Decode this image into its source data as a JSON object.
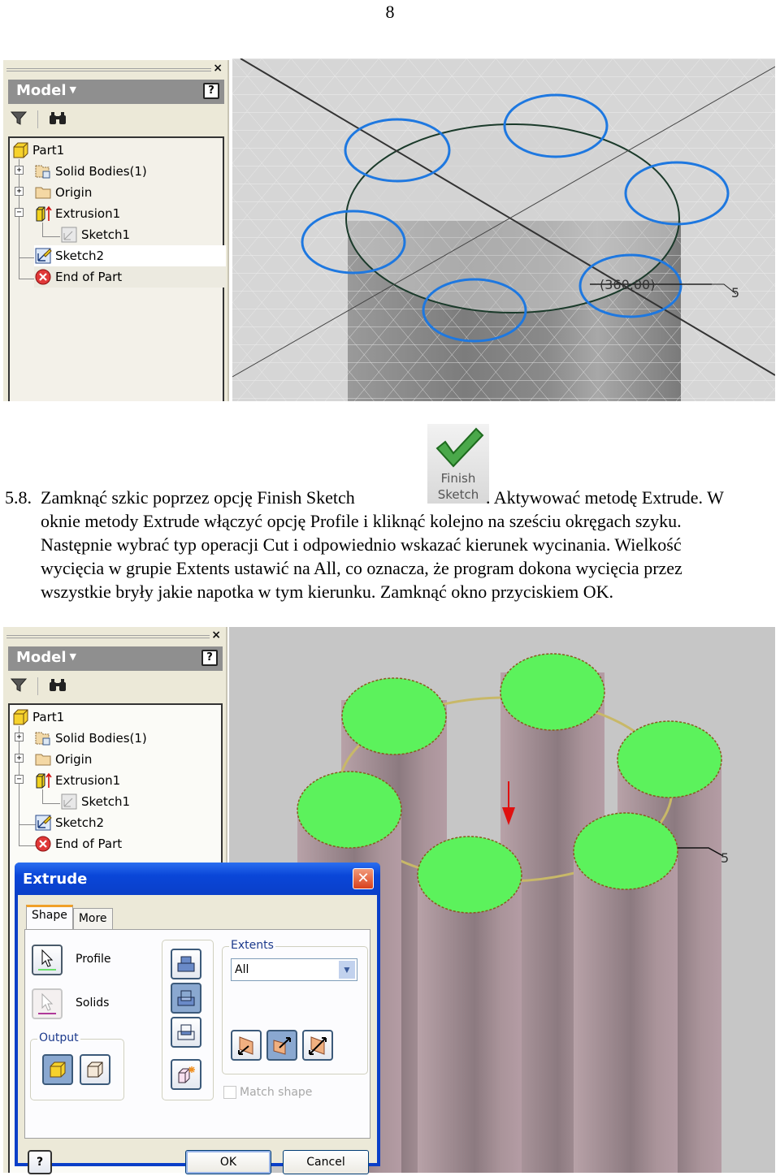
{
  "page": {
    "number": "8"
  },
  "browser": {
    "title": "Model",
    "close_glyph": "×",
    "help_glyph": "?",
    "tools": [
      {
        "icon": "filter-icon"
      },
      {
        "icon": "binoculars-icon"
      }
    ],
    "tree": [
      {
        "label": "Part1",
        "icon": "part-icon",
        "level": 0,
        "expander": ""
      },
      {
        "label": "Solid Bodies(1)",
        "icon": "solid-bodies-icon",
        "level": 1,
        "expander": "+"
      },
      {
        "label": "Origin",
        "icon": "folder-icon",
        "level": 1,
        "expander": "+"
      },
      {
        "label": "Extrusion1",
        "icon": "extrusion-icon",
        "level": 1,
        "expander": "−"
      },
      {
        "label": "Sketch1",
        "icon": "sketch-icon",
        "level": 2,
        "expander": ""
      },
      {
        "label": "Sketch2",
        "icon": "sketch-active-icon",
        "level": 1,
        "expander": "",
        "selected": true
      },
      {
        "label": "End of Part",
        "icon": "end-of-part-icon",
        "level": 1,
        "expander": ""
      }
    ]
  },
  "viewport_top": {
    "sketch_circles": 6,
    "dimension_label": "(360,00)",
    "pattern_count_label": "5",
    "colors": {
      "circle": "#1e78e0",
      "grid": "#c8c8c8",
      "background": "#d8d8d8",
      "cylinder": "#8e8e8e"
    }
  },
  "finish_sketch_icon": {
    "line1": "Finish",
    "line2": "Sketch",
    "check_color": "#3a9a3a"
  },
  "paragraph": {
    "number": "5.8.",
    "lines": [
      {
        "before_icon": "Zamknąć  szkic  poprzez  opcję  Finish  Sketch",
        "after_icon": ".  Aktywować  metodę  Extrude.  W"
      },
      {
        "text": "oknie metody Extrude włączyć opcję Profile i kliknąć kolejno na sześciu okręgach szyku."
      },
      {
        "text": "Następnie wybrać typ operacji Cut i odpowiednio wskazać kierunek wycinania. Wielkość"
      },
      {
        "text": "wycięcia w grupie Extents ustawić na All, co oznacza, że program dokona wycięcia przez"
      },
      {
        "text": "wszystkie bryły jakie napotka w tym kierunku. Zamknąć okno przyciskiem OK."
      }
    ]
  },
  "viewport_bottom": {
    "profiles_selected": 6,
    "pattern_count_label": "5",
    "colors": {
      "profile_fill": "#5cf25c",
      "cylinder": "#a89098",
      "pattern_circle": "#c8b868",
      "direction_arrow": "#e01010",
      "background": "#c6c6c6"
    }
  },
  "extrude_dialog": {
    "title": "Extrude",
    "close_glyph": "✕",
    "tabs": [
      {
        "label": "Shape",
        "active": true
      },
      {
        "label": "More",
        "active": false
      }
    ],
    "profile_label": "Profile",
    "solids_label": "Solids",
    "output_group": "Output",
    "output_options": [
      {
        "name": "solid",
        "on": true
      },
      {
        "name": "surface",
        "on": false
      }
    ],
    "operations": [
      {
        "name": "join",
        "on": false
      },
      {
        "name": "cut",
        "on": true
      },
      {
        "name": "intersect",
        "on": false
      },
      {
        "name": "new-solid",
        "on": false
      }
    ],
    "extents_group": "Extents",
    "extents_value": "All",
    "directions": [
      {
        "name": "direction-1",
        "on": false
      },
      {
        "name": "direction-2",
        "on": true
      },
      {
        "name": "symmetric",
        "on": false
      }
    ],
    "match_shape_label": "Match shape",
    "match_shape_checked": false,
    "help_glyph": "?",
    "ok_label": "OK",
    "cancel_label": "Cancel"
  }
}
